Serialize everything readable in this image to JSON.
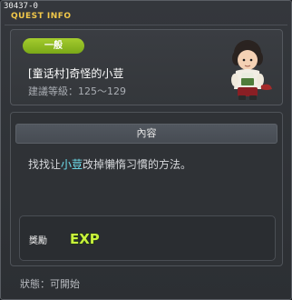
{
  "window": {
    "quest_id": "30437-0",
    "title": "QUEST INFO"
  },
  "quest": {
    "category": "一般",
    "name": "[童话村]奇怪的小荳",
    "level_requirement": "建議等級：125～129"
  },
  "content": {
    "header": "內容",
    "description_before": "找找让",
    "description_highlight": "小荳",
    "description_after": "改掉懶惰习慣的方法。"
  },
  "reward": {
    "label": "獎勵",
    "icon": "exp-icon",
    "icon_text": "EXP"
  },
  "status": "狀態：可開始",
  "colors": {
    "title": "#f2c84a",
    "badge": "#8fbc22",
    "highlight": "#6fe0ef",
    "exp": "#c9f23c"
  }
}
